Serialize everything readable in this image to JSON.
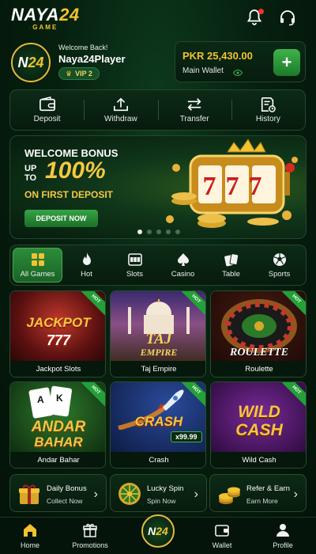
{
  "brand": {
    "name": "NAYA",
    "number": "24",
    "sub": "GAME",
    "stars": "★★★  ★★★"
  },
  "user": {
    "avatar_letter": "N",
    "avatar_number": "24",
    "welcome": "Welcome Back!",
    "name": "Naya24Player",
    "vip": "VIP 2"
  },
  "wallet": {
    "amount": "PKR 25,430.00",
    "label": "Main Wallet",
    "add_symbol": "+"
  },
  "actions": [
    {
      "label": "Deposit",
      "icon": "wallet-icon"
    },
    {
      "label": "Withdraw",
      "icon": "upload-icon"
    },
    {
      "label": "Transfer",
      "icon": "transfer-icon"
    },
    {
      "label": "History",
      "icon": "history-icon"
    }
  ],
  "banner": {
    "title": "WELCOME BONUS",
    "up_to": "UP TO",
    "percent": "100%",
    "subtitle": "ON FIRST DEPOSIT",
    "button": "DEPOSIT NOW",
    "slot_text": "777",
    "slides": 5,
    "active_slide": 1
  },
  "categories": [
    {
      "label": "All Games",
      "icon": "grid-icon",
      "active": true
    },
    {
      "label": "Hot",
      "icon": "flame-icon",
      "active": false
    },
    {
      "label": "Slots",
      "icon": "slot-machine-icon",
      "active": false
    },
    {
      "label": "Casino",
      "icon": "spade-chip-icon",
      "active": false
    },
    {
      "label": "Table",
      "icon": "cards-icon",
      "active": false
    },
    {
      "label": "Sports",
      "icon": "soccer-ball-icon",
      "active": false
    }
  ],
  "games": [
    {
      "name": "Jackpot Slots",
      "art_text": "JACKPOT",
      "art_sub": "777",
      "hot": "HOT"
    },
    {
      "name": "Taj Empire",
      "art_text": "TAJ",
      "art_sub": "EMPIRE",
      "hot": "HOT"
    },
    {
      "name": "Roulette",
      "art_text": "ROULETTE",
      "art_sub": "",
      "hot": "HOT"
    },
    {
      "name": "Andar Bahar",
      "art_text": "ANDAR",
      "art_sub": "BAHAR",
      "hot": "HOT"
    },
    {
      "name": "Crash",
      "art_text": "CRASH",
      "art_sub": "x99.99",
      "hot": "HOT"
    },
    {
      "name": "Wild Cash",
      "art_text": "WILD",
      "art_sub": "CASH",
      "hot": "HOT"
    }
  ],
  "promos": [
    {
      "title": "Daily Bonus",
      "sub": "Collect Now",
      "icon": "gift-icon"
    },
    {
      "title": "Lucky Spin",
      "sub": "Spin Now",
      "icon": "wheel-icon"
    },
    {
      "title": "Refer & Earn",
      "sub": "Earn More",
      "icon": "coins-icon"
    }
  ],
  "nav": [
    {
      "label": "Home",
      "icon": "home-icon"
    },
    {
      "label": "Promotions",
      "icon": "gift-icon"
    },
    {
      "label": "Wallet",
      "icon": "wallet-icon"
    },
    {
      "label": "Profile",
      "icon": "user-icon"
    }
  ],
  "colors": {
    "gold": "#f2c230",
    "green": "#2c8d3b",
    "background": "#06200f"
  }
}
